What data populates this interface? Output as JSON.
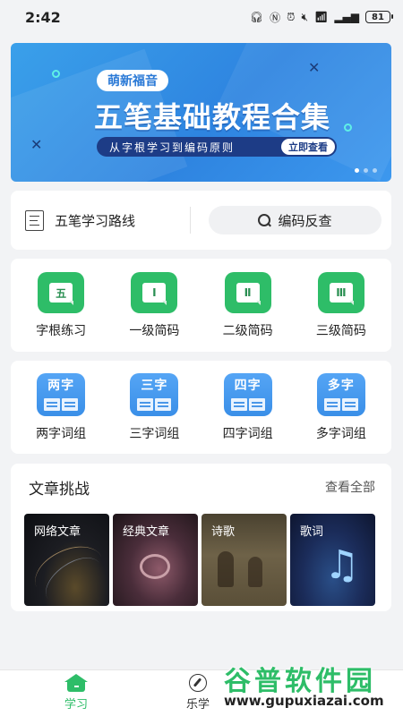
{
  "status_bar": {
    "time": "2:42",
    "battery": "81"
  },
  "banner": {
    "tag": "萌新福音",
    "title": "五笔基础教程合集",
    "subtitle": "从字根学习到编码原则",
    "cta": "立即查看"
  },
  "quick": {
    "route_label": "五笔学习路线",
    "search_label": "编码反查"
  },
  "levels": [
    {
      "glyph": "五",
      "label": "字根练习"
    },
    {
      "glyph": "Ⅰ",
      "label": "一级简码"
    },
    {
      "glyph": "Ⅱ",
      "label": "二级简码"
    },
    {
      "glyph": "Ⅲ",
      "label": "三级简码"
    }
  ],
  "words": [
    {
      "glyph": "两字",
      "label": "两字词组"
    },
    {
      "glyph": "三字",
      "label": "三字词组"
    },
    {
      "glyph": "四字",
      "label": "四字词组"
    },
    {
      "glyph": "多字",
      "label": "多字词组"
    }
  ],
  "articles": {
    "title": "文章挑战",
    "more": "查看全部",
    "items": [
      {
        "label": "网络文章"
      },
      {
        "label": "经典文章"
      },
      {
        "label": "诗歌"
      },
      {
        "label": "歌词"
      }
    ]
  },
  "bottom_nav": {
    "home_label": "学习",
    "music_label": "乐学"
  },
  "watermark": {
    "title": "谷普软件园",
    "url": "www.gupuxiazai.com"
  },
  "colors": {
    "accent_green": "#2ebd68",
    "banner_blue": "#2e84e0",
    "book_blue": "#3a8fe8"
  }
}
